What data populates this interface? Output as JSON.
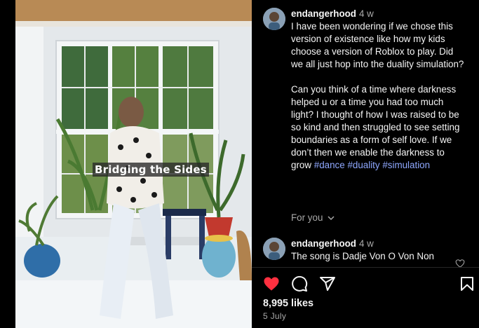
{
  "media": {
    "overlay_text": "Bridging the Sides"
  },
  "comments": [
    {
      "username": "endangerhood",
      "time": "4 w",
      "paragraph1": "I have been wondering if we chose this version of existence like how my kids choose a version of Roblox to play. Did we all just hop into the duality simulation?",
      "paragraph2": "Can you think of a time where darkness helped u or a time you had too much light? I thought of how I was raised to be so kind and then struggled to see setting boundaries as a form of self love. If we don’t then we enable the darkness to grow",
      "hashtags": [
        "#dance",
        "#duality",
        "#simulation"
      ],
      "avatar_icon": "profile-avatar"
    },
    {
      "username": "endangerhood",
      "time": "4 w",
      "text": "The song is Dadje Von O Von Non",
      "avatar_icon": "profile-avatar"
    }
  ],
  "for_you_label": "For you",
  "actions": {
    "like_icon": "heart-filled-icon",
    "comment_icon": "comment-icon",
    "share_icon": "send-icon",
    "save_icon": "bookmark-icon",
    "like_color": "#ff3040"
  },
  "likes_text": "8,995 likes",
  "date_text": "5 July"
}
